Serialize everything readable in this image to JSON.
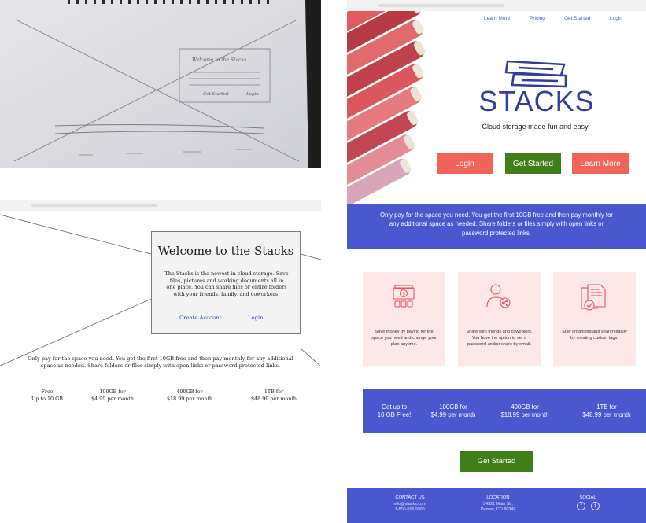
{
  "sketch": {
    "card_title": "Welcome to the Stacks",
    "get_started": "Get Started",
    "login": "Login"
  },
  "wireframe": {
    "title": "Welcome to the Stacks",
    "body": "The Stacks is the newest in cloud storage. Save files, pictures and working documents all in one place. You can share files or entire folders with your friends, family, and coworkers!",
    "create_account": "Create Account",
    "login": "Login",
    "paragraph": "Only pay for the space you need. You get the first 10GB free and then pay monthly for any additional space as needed.  Share folders or files simply with open links or password protected links.",
    "pricing": [
      {
        "line1": "Free",
        "line2": "Up to 10 GB"
      },
      {
        "line1": "100GB for",
        "line2": "$4.99 per month"
      },
      {
        "line1": "400GB  for",
        "line2": "$18.99 per month"
      },
      {
        "line1": "1TB for",
        "line2": "$48.99 per month"
      }
    ]
  },
  "mockup": {
    "nav": {
      "learn_more": "Learn More",
      "pricing": "Pricing",
      "get_started": "Get Started",
      "login": "Login"
    },
    "brand": "STACKS",
    "tagline": "Cloud storage made fun and easy.",
    "buttons": {
      "login": "Login",
      "get_started": "Get Started",
      "learn_more": "Learn More"
    },
    "intro": "Only pay for the space you need. You get the first 10GB free and then pay monthly for any additional space as needed.  Share folders or files simply with open links or password protected links.",
    "features": [
      {
        "icon": "money-storage-icon",
        "text": "Save money by paying for the space you need and change your plan anytime."
      },
      {
        "icon": "share-user-icon",
        "text": "Share with friends and coworkers. You have the option to set a password and/or share by email."
      },
      {
        "icon": "documents-check-icon",
        "text": "Stay organized and search easily by creating custom tags."
      }
    ],
    "pricing": [
      {
        "line1": "Get up to",
        "line2": "10 GB Free!"
      },
      {
        "line1": "100GB for",
        "line2": "$4.99 per month"
      },
      {
        "line1": "400GB  for",
        "line2": "$18.99 per month"
      },
      {
        "line1": "1TB for",
        "line2": "$48.99 per month"
      }
    ],
    "cta": "Get Started",
    "footer": {
      "contact_heading": "CONTACT US",
      "email": "info@stacks.com",
      "phone": "1-800-555-5555",
      "location_heading": "LOCATION",
      "address1": "54321  Main St.,",
      "address2": "Denver, CO 80346",
      "social_heading": "SOCIAL",
      "social_icons": [
        "facebook-icon",
        "twitter-icon"
      ]
    },
    "colors": {
      "blue": "#4a58cf",
      "red": "#f0645a",
      "green": "#3f7e19",
      "brand": "#2f3e9e",
      "feature_bg": "#fde7e7",
      "link": "#3a56d8"
    }
  }
}
